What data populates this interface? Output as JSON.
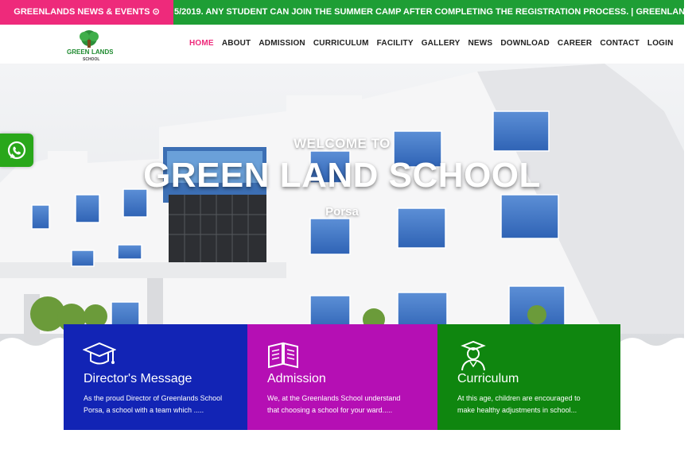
{
  "ticker": {
    "label": "GREENLANDS NEWS & EVENTS ⊙",
    "text": "5/2019. ANY STUDENT CAN JOIN THE SUMMER CAMP AFTER COMPLETING THE REGISTRATION PROCESS.   |   GREENLANDS SCHOOL"
  },
  "logo": {
    "line1": "GREEN",
    "line2": "LANDS",
    "line3": "SCHOOL"
  },
  "nav": [
    "HOME",
    "ABOUT",
    "ADMISSION",
    "CURRICULUM",
    "FACILITY",
    "GALLERY",
    "NEWS",
    "DOWNLOAD",
    "CAREER",
    "CONTACT",
    "LOGIN"
  ],
  "hero": {
    "small": "WELCOME TO",
    "title": "GREEN LAND SCHOOL",
    "sub": "Porsa"
  },
  "cards": [
    {
      "title": "Director's Message",
      "line1": "As the proud Director of Greenlands School",
      "line2": "Porsa, a school with a team which ....."
    },
    {
      "title": "Admission",
      "line1": "We, at the Greenlands School understand",
      "line2": "that choosing a school for your ward....."
    },
    {
      "title": "Curriculum",
      "line1": "At this age, children are encouraged to",
      "line2": "make healthy adjustments in school..."
    }
  ],
  "colors": {
    "ticker_label": "#ee2a7b",
    "ticker_bar": "#1e9e35",
    "card1": "#1224b5",
    "card2": "#b50fb4",
    "card3": "#0f860f",
    "nav_active": "#ee2a7b"
  }
}
